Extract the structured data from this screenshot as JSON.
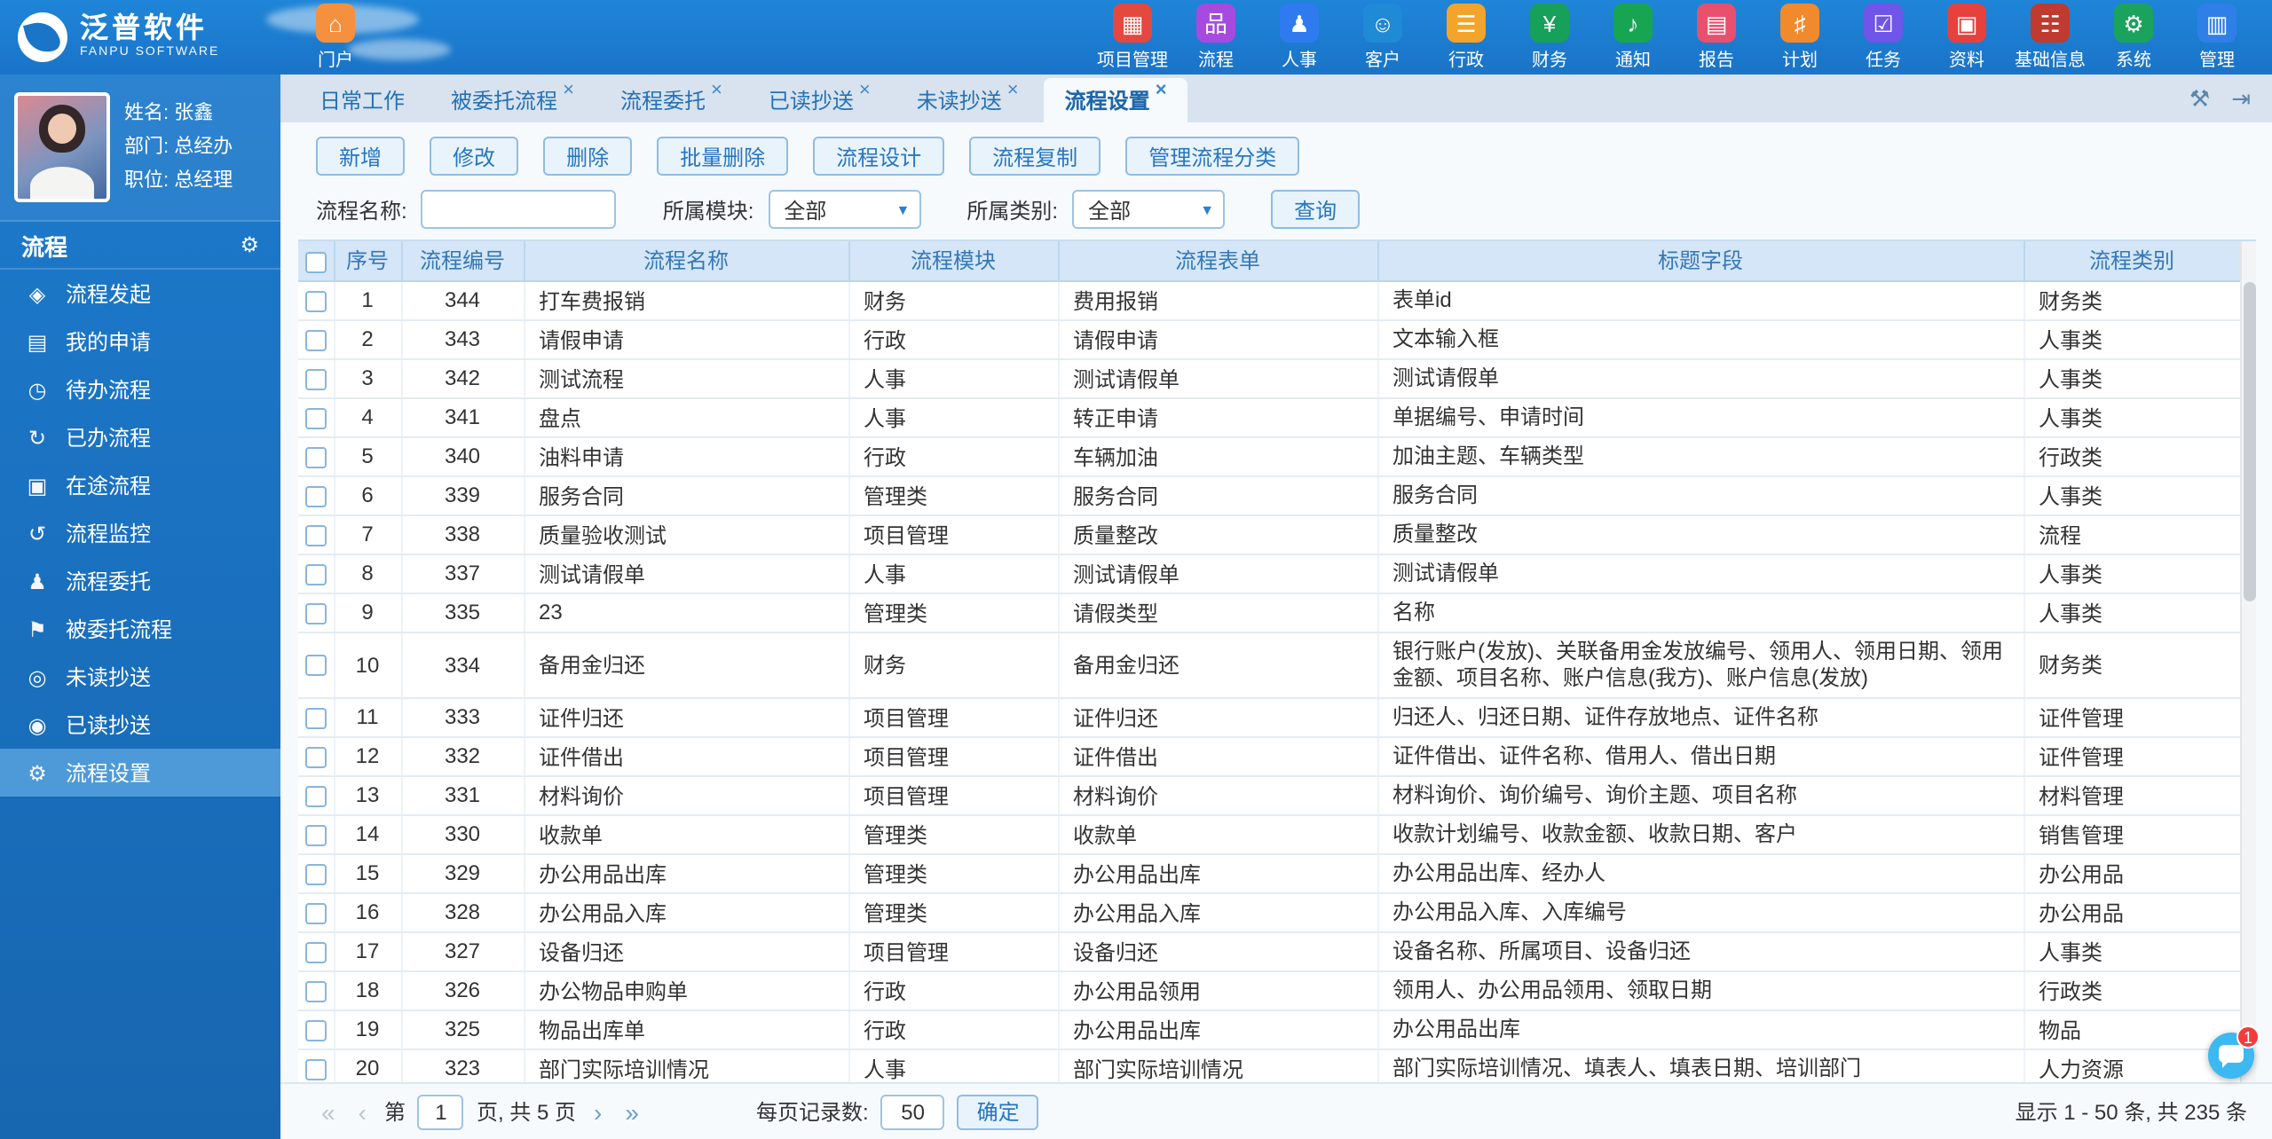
{
  "brand": {
    "name": "泛普软件",
    "subtitle": "FANPU SOFTWARE"
  },
  "header": {
    "portal": {
      "label": "门户",
      "icon": "⌂",
      "color": "#f5913e"
    },
    "apps": [
      {
        "label": "项目管理",
        "icon": "▦",
        "color": "#e3493f"
      },
      {
        "label": "流程",
        "icon": "品",
        "color": "#a64ae0"
      },
      {
        "label": "人事",
        "icon": "♟",
        "color": "#2e7bf0"
      },
      {
        "label": "客户",
        "icon": "☺",
        "color": "#1f8ad6"
      },
      {
        "label": "行政",
        "icon": "☰",
        "color": "#f3a42a"
      },
      {
        "label": "财务",
        "icon": "¥",
        "color": "#16a05a"
      },
      {
        "label": "通知",
        "icon": "♪",
        "color": "#17a552"
      },
      {
        "label": "报告",
        "icon": "▤",
        "color": "#e8506e"
      },
      {
        "label": "计划",
        "icon": "♯",
        "color": "#f08a2d"
      },
      {
        "label": "任务",
        "icon": "☑",
        "color": "#6f55e8"
      },
      {
        "label": "资料",
        "icon": "▣",
        "color": "#e6413c"
      },
      {
        "label": "基础信息",
        "icon": "☷",
        "color": "#bf3a2f"
      },
      {
        "label": "系统",
        "icon": "⚙",
        "color": "#1ba35e"
      },
      {
        "label": "管理",
        "icon": "▥",
        "color": "#2f7fe8"
      }
    ]
  },
  "user": {
    "name": "姓名: 张鑫",
    "dept": "部门: 总经办",
    "title": "职位: 总经理"
  },
  "sidebar": {
    "section": "流程",
    "gear_icon": "⚙",
    "items": [
      {
        "label": "流程发起",
        "icon": "◈"
      },
      {
        "label": "我的申请",
        "icon": "▤"
      },
      {
        "label": "待办流程",
        "icon": "◷"
      },
      {
        "label": "已办流程",
        "icon": "↻"
      },
      {
        "label": "在途流程",
        "icon": "▣"
      },
      {
        "label": "流程监控",
        "icon": "↺"
      },
      {
        "label": "流程委托",
        "icon": "♟"
      },
      {
        "label": "被委托流程",
        "icon": "⚑"
      },
      {
        "label": "未读抄送",
        "icon": "◎"
      },
      {
        "label": "已读抄送",
        "icon": "◉"
      },
      {
        "label": "流程设置",
        "icon": "⚙",
        "active": true
      }
    ]
  },
  "tabs": [
    {
      "label": "日常工作"
    },
    {
      "label": "被委托流程",
      "closable": true,
      "close": "×"
    },
    {
      "label": "流程委托",
      "closable": true,
      "close": "×"
    },
    {
      "label": "已读抄送",
      "closable": true,
      "close": "×"
    },
    {
      "label": "未读抄送",
      "closable": true,
      "close": "×"
    },
    {
      "label": "流程设置",
      "closable": true,
      "close": "×",
      "active": true
    }
  ],
  "tab_actions": {
    "wrench_icon": "⚒",
    "exit_icon": "⇥"
  },
  "toolbar": {
    "buttons": [
      {
        "label": "新增"
      },
      {
        "label": "修改"
      },
      {
        "label": "删除"
      },
      {
        "label": "批量删除"
      },
      {
        "label": "流程设计"
      },
      {
        "label": "流程复制"
      },
      {
        "label": "管理流程分类"
      }
    ]
  },
  "filters": {
    "name_label": "流程名称:",
    "name_value": "",
    "module_label": "所属模块:",
    "module_value": "全部",
    "category_label": "所属类别:",
    "category_value": "全部",
    "search_button": "查询",
    "caret_icon": "▼"
  },
  "table": {
    "headers": [
      "序号",
      "流程编号",
      "流程名称",
      "流程模块",
      "流程表单",
      "标题字段",
      "流程类别"
    ],
    "rows": [
      {
        "idx": 1,
        "no": 344,
        "name": "打车费报销",
        "module": "财务",
        "form": "费用报销",
        "field": "表单id",
        "cat": "财务类"
      },
      {
        "idx": 2,
        "no": 343,
        "name": "请假申请",
        "module": "行政",
        "form": "请假申请",
        "field": "文本输入框",
        "cat": "人事类"
      },
      {
        "idx": 3,
        "no": 342,
        "name": "测试流程",
        "module": "人事",
        "form": "测试请假单",
        "field": "测试请假单",
        "cat": "人事类"
      },
      {
        "idx": 4,
        "no": 341,
        "name": "盘点",
        "module": "人事",
        "form": "转正申请",
        "field": "单据编号、申请时间",
        "cat": "人事类"
      },
      {
        "idx": 5,
        "no": 340,
        "name": "油料申请",
        "module": "行政",
        "form": "车辆加油",
        "field": "加油主题、车辆类型",
        "cat": "行政类"
      },
      {
        "idx": 6,
        "no": 339,
        "name": "服务合同",
        "module": "管理类",
        "form": "服务合同",
        "field": "服务合同",
        "cat": "人事类"
      },
      {
        "idx": 7,
        "no": 338,
        "name": "质量验收测试",
        "module": "项目管理",
        "form": "质量整改",
        "field": "质量整改",
        "cat": "流程"
      },
      {
        "idx": 8,
        "no": 337,
        "name": "测试请假单",
        "module": "人事",
        "form": "测试请假单",
        "field": "测试请假单",
        "cat": "人事类"
      },
      {
        "idx": 9,
        "no": 335,
        "name": "23",
        "module": "管理类",
        "form": "请假类型",
        "field": "名称",
        "cat": "人事类"
      },
      {
        "idx": 10,
        "no": 334,
        "name": "备用金归还",
        "module": "财务",
        "form": "备用金归还",
        "field": "银行账户(发放)、关联备用金发放编号、领用人、领用日期、领用金额、项目名称、账户信息(我方)、账户信息(发放)",
        "cat": "财务类"
      },
      {
        "idx": 11,
        "no": 333,
        "name": "证件归还",
        "module": "项目管理",
        "form": "证件归还",
        "field": "归还人、归还日期、证件存放地点、证件名称",
        "cat": "证件管理"
      },
      {
        "idx": 12,
        "no": 332,
        "name": "证件借出",
        "module": "项目管理",
        "form": "证件借出",
        "field": "证件借出、证件名称、借用人、借出日期",
        "cat": "证件管理"
      },
      {
        "idx": 13,
        "no": 331,
        "name": "材料询价",
        "module": "项目管理",
        "form": "材料询价",
        "field": "材料询价、询价编号、询价主题、项目名称",
        "cat": "材料管理"
      },
      {
        "idx": 14,
        "no": 330,
        "name": "收款单",
        "module": "管理类",
        "form": "收款单",
        "field": "收款计划编号、收款金额、收款日期、客户",
        "cat": "销售管理"
      },
      {
        "idx": 15,
        "no": 329,
        "name": "办公用品出库",
        "module": "管理类",
        "form": "办公用品出库",
        "field": "办公用品出库、经办人",
        "cat": "办公用品"
      },
      {
        "idx": 16,
        "no": 328,
        "name": "办公用品入库",
        "module": "管理类",
        "form": "办公用品入库",
        "field": "办公用品入库、入库编号",
        "cat": "办公用品"
      },
      {
        "idx": 17,
        "no": 327,
        "name": "设备归还",
        "module": "项目管理",
        "form": "设备归还",
        "field": "设备名称、所属项目、设备归还",
        "cat": "人事类"
      },
      {
        "idx": 18,
        "no": 326,
        "name": "办公物品申购单",
        "module": "行政",
        "form": "办公用品领用",
        "field": "领用人、办公用品领用、领取日期",
        "cat": "行政类"
      },
      {
        "idx": 19,
        "no": 325,
        "name": "物品出库单",
        "module": "行政",
        "form": "办公用品出库",
        "field": "办公用品出库",
        "cat": "物品"
      },
      {
        "idx": 20,
        "no": 323,
        "name": "部门实际培训情况",
        "module": "人事",
        "form": "部门实际培训情况",
        "field": "部门实际培训情况、填表人、填表日期、培训部门",
        "cat": "人力资源"
      }
    ]
  },
  "pagination": {
    "first_icon": "«",
    "prev_icon": "‹",
    "next_icon": "›",
    "last_icon": "»",
    "page_prefix": "第",
    "page_value": "1",
    "page_suffix": "页, 共 5 页",
    "per_page_label": "每页记录数:",
    "per_page_value": "50",
    "confirm_button": "确定",
    "summary": "显示 1 - 50 条, 共 235 条"
  },
  "chat": {
    "badge": "1"
  }
}
